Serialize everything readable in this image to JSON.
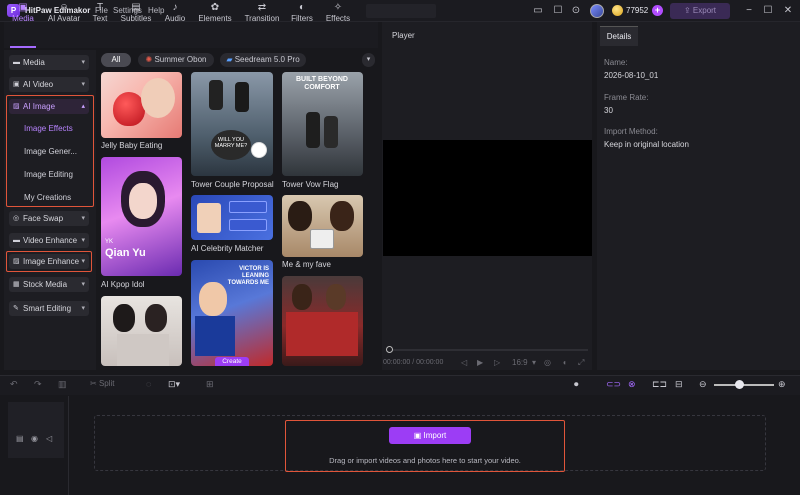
{
  "app": {
    "title": "HitPaw Edimakor",
    "credits": "77952",
    "export_label": "Export"
  },
  "menu": [
    "File",
    "Settings",
    "Help"
  ],
  "top_tabs": [
    {
      "label": "Media",
      "icon": "media-icon"
    },
    {
      "label": "AI Avatar",
      "icon": "avatar-icon"
    },
    {
      "label": "Text",
      "icon": "text-icon"
    },
    {
      "label": "Subtitles",
      "icon": "subtitles-icon"
    },
    {
      "label": "Audio",
      "icon": "audio-icon"
    },
    {
      "label": "Elements",
      "icon": "elements-icon"
    },
    {
      "label": "Transition",
      "icon": "transition-icon"
    },
    {
      "label": "Filters",
      "icon": "filters-icon"
    },
    {
      "label": "Effects",
      "icon": "effects-icon"
    }
  ],
  "sidebar": {
    "media": "Media",
    "ai_video": "AI Video",
    "ai_image": "AI Image",
    "ai_image_sub": [
      "Image Effects",
      "Image Gener...",
      "Image Editing",
      "My Creations"
    ],
    "face_swap": "Face Swap",
    "video_enhance": "Video Enhance",
    "image_enhance": "Image Enhance",
    "stock_media": "Stock Media",
    "smart_editing": "Smart Editing"
  },
  "chips": {
    "all": "All",
    "summer": "Summer Obon",
    "seedream": "Seedream 5.0 Pro"
  },
  "gallery": [
    {
      "caption": "Jelly Baby Eating"
    },
    {
      "caption": "Tower Couple Proposal"
    },
    {
      "caption": "Tower Vow Flag"
    },
    {
      "caption": "AI Kpop Idol",
      "overlay_small": "YK",
      "overlay_big": "Qian Yu"
    },
    {
      "caption": "AI Celebrity Matcher"
    },
    {
      "caption": "Me & my fave"
    },
    {
      "caption": "",
      "overlay_text": "VICTOR IS LEANING TOWARDS ME"
    },
    {
      "caption": ""
    },
    {
      "caption": ""
    }
  ],
  "thumb_text": {
    "will_you": "WILL YOU MARRY ME?",
    "built": "BUILT BEYOND COMFORT",
    "create": "Create"
  },
  "player": {
    "title": "Player",
    "timecode": "00:00:00 / 00:00:00",
    "ratio": "16:9"
  },
  "details": {
    "tab": "Details",
    "name_label": "Name:",
    "name_value": "2026-08-10_01",
    "frame_label": "Frame Rate:",
    "frame_value": "30",
    "import_label": "Import Method:",
    "import_value": "Keep in original location"
  },
  "timeline": {
    "split": "Split",
    "import_label": "Import",
    "hint": "Drag or import videos and photos here to start your video."
  }
}
